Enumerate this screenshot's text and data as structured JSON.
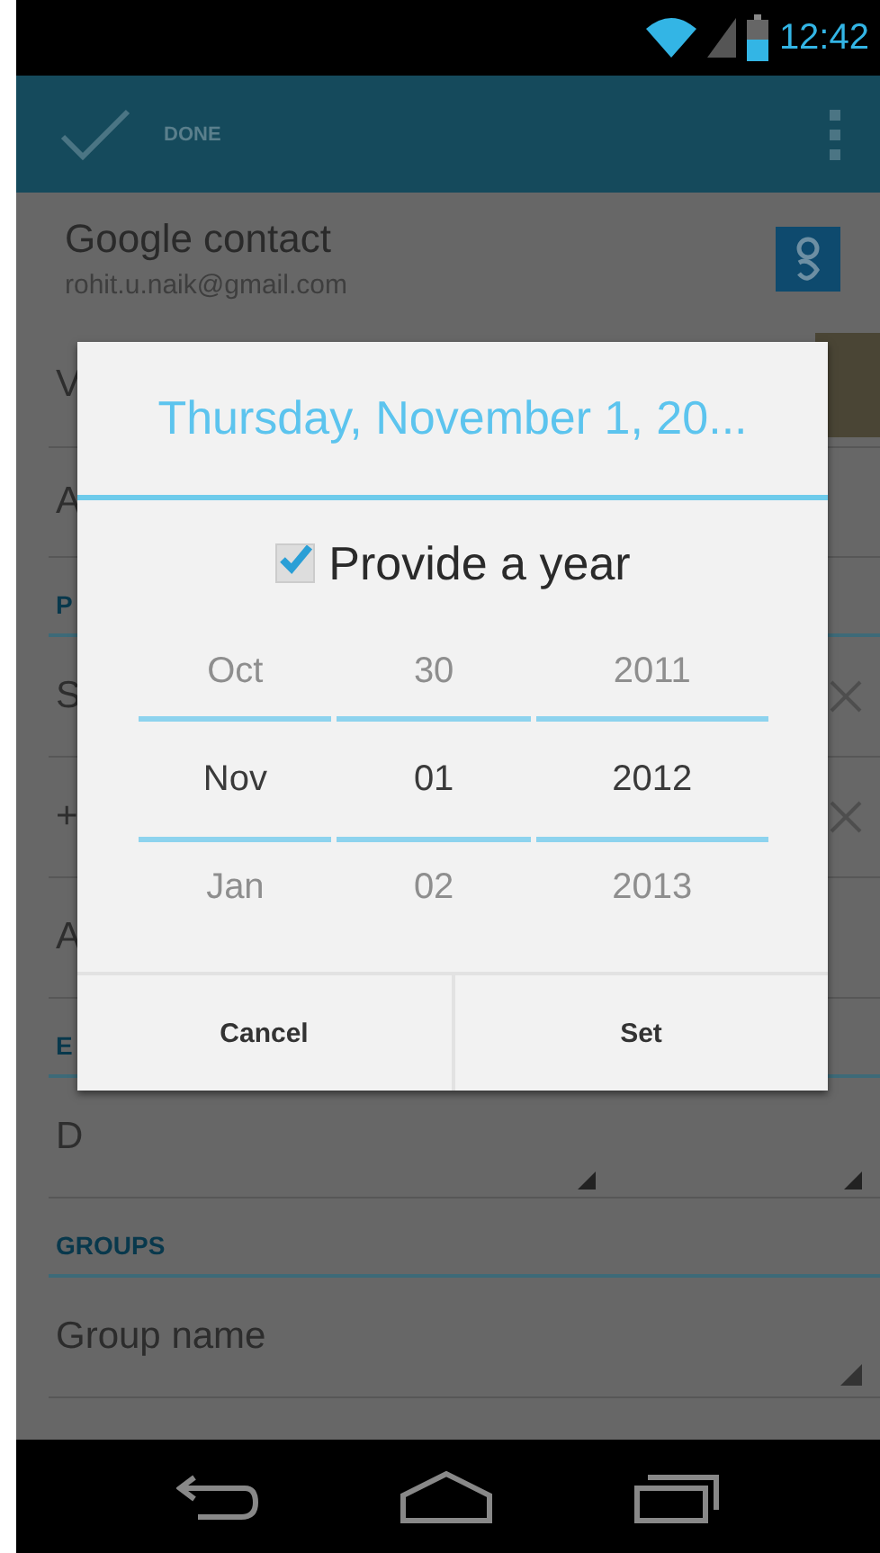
{
  "status_bar": {
    "time": "12:42"
  },
  "action_bar": {
    "done_label": "DONE"
  },
  "account": {
    "title": "Google contact",
    "email": "rohit.u.naik@gmail.com"
  },
  "form_rows": [
    {
      "kind": "photo_field",
      "text": "V"
    },
    {
      "kind": "field",
      "text": "A"
    },
    {
      "kind": "header",
      "text": "P"
    },
    {
      "kind": "removable_field",
      "text": "S"
    },
    {
      "kind": "removable_field",
      "text": "+"
    },
    {
      "kind": "field",
      "text": "A"
    },
    {
      "kind": "header",
      "text": "E"
    },
    {
      "kind": "date_field",
      "text": "D"
    },
    {
      "kind": "header",
      "text": "GROUPS"
    },
    {
      "kind": "input",
      "placeholder": "Group name"
    }
  ],
  "dialog": {
    "title": "Thursday, November 1, 20...",
    "checkbox": {
      "label": "Provide a year",
      "checked": true
    },
    "picker_columns": [
      {
        "previous": "Oct",
        "current": "Nov",
        "next": "Jan"
      },
      {
        "previous": "30",
        "current": "01",
        "next": "02"
      },
      {
        "previous": "2011",
        "current": "2012",
        "next": "2013"
      }
    ],
    "buttons": [
      "Cancel",
      "Set"
    ]
  }
}
